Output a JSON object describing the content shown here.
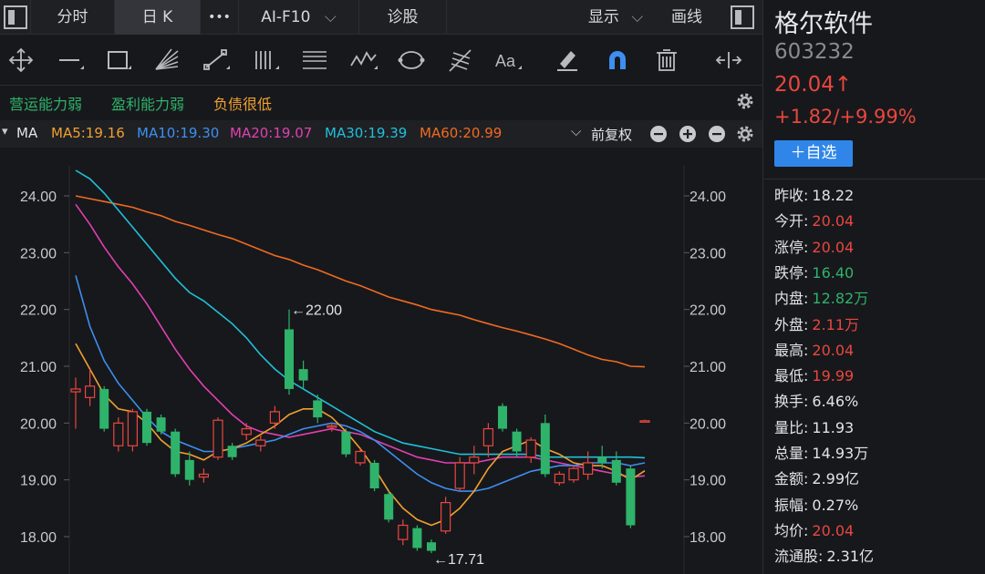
{
  "tabs": {
    "fenshi": "分时",
    "rik": "日 K",
    "more": "•••",
    "aif10": "AI-F10",
    "zhengu": "诊股",
    "display": "显示",
    "draw": "画线"
  },
  "toolbar": {
    "icons": [
      "crosshair-icon",
      "hline-icon",
      "rect-icon",
      "fan-icon",
      "segment-icon",
      "channel-icon",
      "fib-icon",
      "wave-icon",
      "ellipse-icon",
      "pitchfork-icon",
      "text-icon",
      "eraser-icon",
      "magnet-icon",
      "trash-icon",
      "expand-icon"
    ]
  },
  "tags": {
    "t1": "营运能力弱",
    "t2": "盈利能力弱",
    "t3": "负债很低"
  },
  "ma": {
    "label": "MA",
    "ma5": "MA5:19.16",
    "ma10": "MA10:19.30",
    "ma20": "MA20:19.07",
    "ma30": "MA30:19.39",
    "ma60": "MA60:20.99",
    "adjust": "前复权"
  },
  "colors": {
    "up": "#e9473e",
    "down": "#2fb36a",
    "ma5": "#f0a030",
    "ma10": "#3d8ff0",
    "ma20": "#e040b0",
    "ma30": "#20c0d8",
    "ma60": "#f06a20"
  },
  "chart_data": {
    "type": "candlestick",
    "yticks": [
      "24.00",
      "23.00",
      "22.00",
      "21.00",
      "20.00",
      "19.00",
      "18.00"
    ],
    "yvalues": [
      24,
      23,
      22,
      21,
      20,
      19,
      18
    ],
    "ylim": [
      17.6,
      24.6
    ],
    "high_annotation": "←22.00",
    "low_annotation": "←17.71",
    "high_value": 22.0,
    "low_value": 17.71,
    "candles": [
      {
        "o": 20.55,
        "c": 20.6,
        "h": 20.8,
        "l": 19.9
      },
      {
        "o": 20.45,
        "c": 20.65,
        "h": 20.95,
        "l": 20.3
      },
      {
        "o": 20.6,
        "c": 19.9,
        "h": 20.65,
        "l": 19.85
      },
      {
        "o": 19.6,
        "c": 20.0,
        "h": 20.1,
        "l": 19.5
      },
      {
        "o": 19.6,
        "c": 20.2,
        "h": 20.25,
        "l": 19.5
      },
      {
        "o": 20.2,
        "c": 19.65,
        "h": 20.25,
        "l": 19.6
      },
      {
        "o": 20.1,
        "c": 19.85,
        "h": 20.15,
        "l": 19.8
      },
      {
        "o": 19.85,
        "c": 19.1,
        "h": 19.9,
        "l": 19.05
      },
      {
        "o": 19.35,
        "c": 19.0,
        "h": 19.5,
        "l": 18.9
      },
      {
        "o": 19.05,
        "c": 19.1,
        "h": 19.2,
        "l": 18.95
      },
      {
        "o": 19.4,
        "c": 20.05,
        "h": 20.1,
        "l": 19.35
      },
      {
        "o": 19.6,
        "c": 19.4,
        "h": 19.65,
        "l": 19.35
      },
      {
        "o": 19.8,
        "c": 19.9,
        "h": 20.0,
        "l": 19.7
      },
      {
        "o": 19.6,
        "c": 19.7,
        "h": 19.8,
        "l": 19.5
      },
      {
        "o": 20.0,
        "c": 20.2,
        "h": 20.3,
        "l": 19.9
      },
      {
        "o": 21.65,
        "c": 20.6,
        "h": 22.0,
        "l": 20.5
      },
      {
        "o": 20.95,
        "c": 20.75,
        "h": 21.1,
        "l": 20.6
      },
      {
        "o": 20.4,
        "c": 20.1,
        "h": 20.5,
        "l": 20.0
      },
      {
        "o": 19.95,
        "c": 19.95,
        "h": 20.0,
        "l": 19.85
      },
      {
        "o": 19.85,
        "c": 19.45,
        "h": 19.9,
        "l": 19.4
      },
      {
        "o": 19.3,
        "c": 19.5,
        "h": 19.55,
        "l": 19.25
      },
      {
        "o": 19.3,
        "c": 18.85,
        "h": 19.35,
        "l": 18.8
      },
      {
        "o": 18.75,
        "c": 18.3,
        "h": 18.8,
        "l": 18.25
      },
      {
        "o": 17.95,
        "c": 18.2,
        "h": 18.3,
        "l": 17.85
      },
      {
        "o": 18.15,
        "c": 17.8,
        "h": 18.2,
        "l": 17.75
      },
      {
        "o": 17.9,
        "c": 17.75,
        "h": 17.95,
        "l": 17.71
      },
      {
        "o": 18.1,
        "c": 18.6,
        "h": 18.7,
        "l": 18.05
      },
      {
        "o": 18.85,
        "c": 19.3,
        "h": 19.4,
        "l": 18.8
      },
      {
        "o": 19.3,
        "c": 19.4,
        "h": 19.6,
        "l": 19.1
      },
      {
        "o": 19.6,
        "c": 19.9,
        "h": 20.0,
        "l": 19.4
      },
      {
        "o": 20.3,
        "c": 19.9,
        "h": 20.35,
        "l": 19.85
      },
      {
        "o": 19.85,
        "c": 19.5,
        "h": 19.9,
        "l": 19.4
      },
      {
        "o": 19.4,
        "c": 19.7,
        "h": 19.75,
        "l": 19.3
      },
      {
        "o": 20.0,
        "c": 19.1,
        "h": 20.15,
        "l": 19.05
      },
      {
        "o": 18.95,
        "c": 19.1,
        "h": 19.15,
        "l": 18.9
      },
      {
        "o": 19.0,
        "c": 19.2,
        "h": 19.25,
        "l": 18.95
      },
      {
        "o": 19.1,
        "c": 19.3,
        "h": 19.5,
        "l": 19.0
      },
      {
        "o": 19.4,
        "c": 19.3,
        "h": 19.6,
        "l": 19.2
      },
      {
        "o": 19.35,
        "c": 18.95,
        "h": 19.5,
        "l": 18.9
      },
      {
        "o": 19.2,
        "c": 18.2,
        "h": 19.25,
        "l": 18.15
      },
      {
        "o": 20.04,
        "c": 20.04,
        "h": 20.06,
        "l": 20.02
      }
    ],
    "ma5": [
      21.4,
      20.95,
      20.5,
      20.25,
      20.2,
      20.0,
      19.7,
      19.5,
      19.45,
      19.35,
      19.5,
      19.55,
      19.65,
      19.8,
      19.95,
      20.15,
      20.25,
      20.25,
      20.1,
      19.85,
      19.55,
      19.2,
      18.8,
      18.5,
      18.3,
      18.2,
      18.3,
      18.5,
      18.8,
      19.2,
      19.5,
      19.6,
      19.7,
      19.55,
      19.45,
      19.3,
      19.25,
      19.25,
      19.15,
      19.0,
      19.16
    ],
    "ma10": [
      22.6,
      21.7,
      21.1,
      20.7,
      20.4,
      20.1,
      19.85,
      19.7,
      19.6,
      19.5,
      19.5,
      19.55,
      19.6,
      19.65,
      19.7,
      19.8,
      19.9,
      19.95,
      20.0,
      19.95,
      19.85,
      19.7,
      19.5,
      19.3,
      19.1,
      18.95,
      18.85,
      18.8,
      18.8,
      18.85,
      18.95,
      19.05,
      19.15,
      19.2,
      19.25,
      19.25,
      19.3,
      19.3,
      19.3,
      19.25,
      19.3
    ],
    "ma20": [
      23.85,
      23.5,
      23.1,
      22.75,
      22.45,
      22.1,
      21.7,
      21.3,
      20.95,
      20.65,
      20.4,
      20.15,
      19.95,
      19.85,
      19.8,
      19.75,
      19.8,
      19.85,
      19.9,
      19.85,
      19.8,
      19.7,
      19.6,
      19.5,
      19.4,
      19.35,
      19.3,
      19.3,
      19.3,
      19.35,
      19.4,
      19.4,
      19.4,
      19.35,
      19.3,
      19.25,
      19.2,
      19.15,
      19.1,
      19.05,
      19.07
    ],
    "ma30": [
      24.45,
      24.3,
      24.05,
      23.75,
      23.45,
      23.15,
      22.85,
      22.55,
      22.3,
      22.15,
      21.95,
      21.75,
      21.5,
      21.2,
      20.95,
      20.75,
      20.6,
      20.45,
      20.3,
      20.15,
      20.0,
      19.85,
      19.75,
      19.65,
      19.6,
      19.55,
      19.5,
      19.45,
      19.45,
      19.45,
      19.45,
      19.45,
      19.45,
      19.4,
      19.4,
      19.4,
      19.4,
      19.4,
      19.4,
      19.4,
      19.39
    ],
    "ma60": [
      24.0,
      23.95,
      23.9,
      23.85,
      23.8,
      23.72,
      23.65,
      23.55,
      23.48,
      23.4,
      23.32,
      23.25,
      23.15,
      23.05,
      22.95,
      22.88,
      22.78,
      22.7,
      22.6,
      22.5,
      22.42,
      22.32,
      22.22,
      22.15,
      22.08,
      22.0,
      21.95,
      21.9,
      21.82,
      21.75,
      21.68,
      21.62,
      21.55,
      21.48,
      21.4,
      21.3,
      21.2,
      21.12,
      21.08,
      21.0,
      20.99
    ]
  },
  "stock": {
    "name": "格尔软件",
    "code": "603232",
    "price": "20.04↑",
    "change": "+1.82/+9.99%",
    "add_label": "＋自选"
  },
  "stats": [
    {
      "label": "昨收:",
      "value": "18.22",
      "color": "white"
    },
    {
      "label": "今开:",
      "value": "20.04",
      "color": "red"
    },
    {
      "label": "涨停:",
      "value": "20.04",
      "color": "red"
    },
    {
      "label": "跌停:",
      "value": "16.40",
      "color": "green"
    },
    {
      "label": "内盘:",
      "value": "12.82万",
      "color": "green"
    },
    {
      "label": "外盘:",
      "value": "2.11万",
      "color": "red"
    },
    {
      "label": "最高:",
      "value": "20.04",
      "color": "red"
    },
    {
      "label": "最低:",
      "value": "19.99",
      "color": "red"
    },
    {
      "label": "换手:",
      "value": "6.46%",
      "color": "white"
    },
    {
      "label": "量比:",
      "value": "11.93",
      "color": "white"
    },
    {
      "label": "总量:",
      "value": "14.93万",
      "color": "white"
    },
    {
      "label": "金额:",
      "value": "2.99亿",
      "color": "white"
    },
    {
      "label": "振幅:",
      "value": "0.27%",
      "color": "white"
    },
    {
      "label": "均价:",
      "value": "20.04",
      "color": "red"
    },
    {
      "label": "流通股:",
      "value": "2.31亿",
      "color": "white"
    }
  ]
}
